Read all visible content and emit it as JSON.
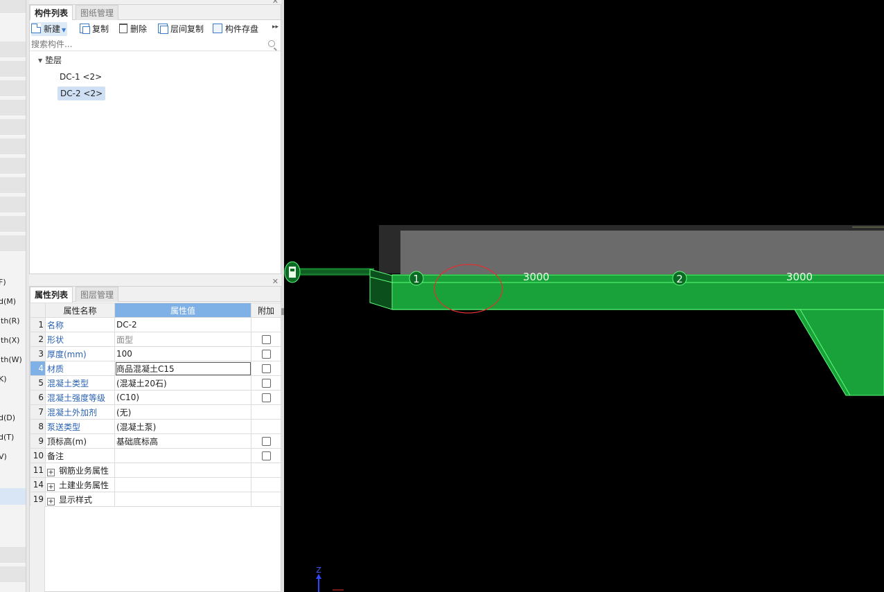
{
  "sidebar": {
    "labels": [
      "F)",
      "d(M)",
      "ith(R)",
      "ith(X)",
      "ith(W)",
      "K)",
      "d(D)",
      "d(T)",
      "V)"
    ]
  },
  "component_panel": {
    "tabs": [
      "构件列表",
      "图纸管理"
    ],
    "toolbar": {
      "new_label": "新建",
      "copy_label": "复制",
      "delete_label": "删除",
      "floor_copy_label": "层间复制",
      "save_label": "构件存盘"
    },
    "search_placeholder": "搜索构件...",
    "tree": {
      "group": "垫层",
      "items": [
        "DC-1 <2>",
        "DC-2 <2>"
      ]
    }
  },
  "property_panel": {
    "tabs": [
      "属性列表",
      "图层管理"
    ],
    "headers": {
      "name": "属性名称",
      "value": "属性值",
      "extra": "附加"
    },
    "rows": [
      {
        "idx": "1",
        "name": "名称",
        "value": "DC-2"
      },
      {
        "idx": "2",
        "name": "形状",
        "value": "面型"
      },
      {
        "idx": "3",
        "name": "厚度(mm)",
        "value": "100"
      },
      {
        "idx": "4",
        "name": "材质",
        "value": "商品混凝土C15"
      },
      {
        "idx": "5",
        "name": "混凝土类型",
        "value": "(混凝土20石)"
      },
      {
        "idx": "6",
        "name": "混凝土强度等级",
        "value": "(C10)"
      },
      {
        "idx": "7",
        "name": "混凝土外加剂",
        "value": "(无)"
      },
      {
        "idx": "8",
        "name": "泵送类型",
        "value": "(混凝土泵)"
      },
      {
        "idx": "9",
        "name": "顶标高(m)",
        "value": "基础底标高"
      },
      {
        "idx": "10",
        "name": "备注",
        "value": ""
      },
      {
        "idx": "11",
        "name": "钢筋业务属性",
        "value": ""
      },
      {
        "idx": "14",
        "name": "土建业务属性",
        "value": ""
      },
      {
        "idx": "19",
        "name": "显示样式",
        "value": ""
      }
    ]
  },
  "viewport": {
    "axis_labels": [
      "1",
      "2"
    ],
    "dimensions": [
      "3000",
      "3000"
    ],
    "z_axis": "Z",
    "colors": {
      "slab": "#19a23a",
      "edge": "#5dff7a",
      "wall": "#6b6b6b",
      "highlight": "#e03030"
    }
  }
}
